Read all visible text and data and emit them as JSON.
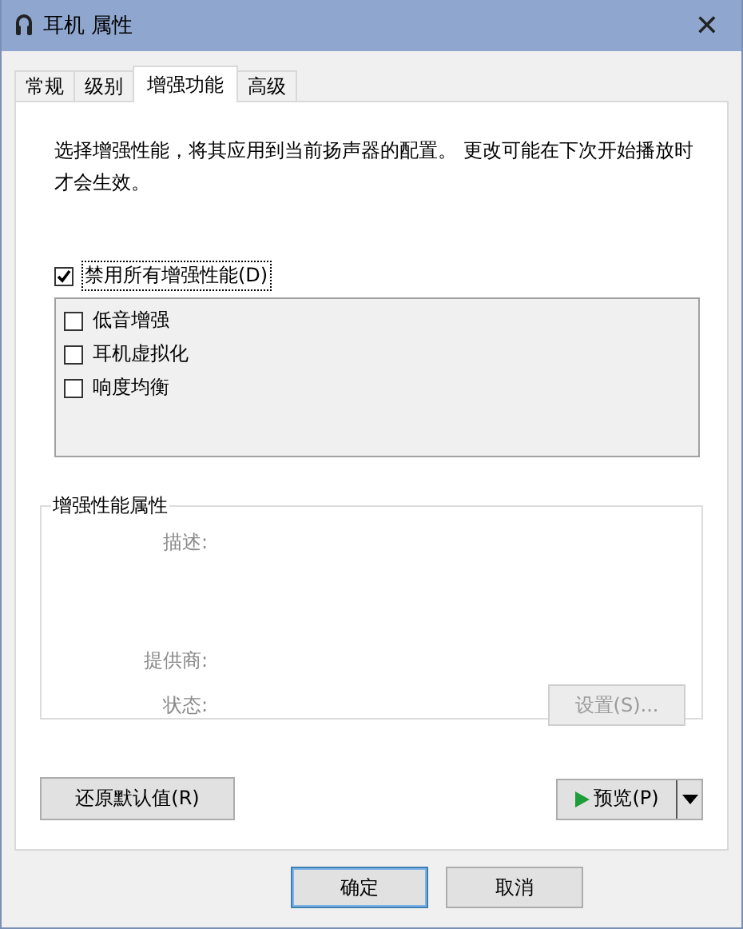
{
  "window": {
    "title": "耳机 属性",
    "close": "✕"
  },
  "tabs": [
    {
      "label": "常规",
      "selected": false
    },
    {
      "label": "级别",
      "selected": false
    },
    {
      "label": "增强功能",
      "selected": true
    },
    {
      "label": "高级",
      "selected": false
    }
  ],
  "description": "选择增强性能，将其应用到当前扬声器的配置。 更改可能在下次开始播放时才会生效。",
  "disable_all": {
    "label": "禁用所有增强性能(D)",
    "checked": true
  },
  "enhancements": [
    {
      "label": "低音增强",
      "checked": false
    },
    {
      "label": "耳机虚拟化",
      "checked": false
    },
    {
      "label": "响度均衡",
      "checked": false
    }
  ],
  "properties": {
    "title": "增强性能属性",
    "fields": [
      {
        "label": "描述:"
      },
      {
        "label": "提供商:"
      },
      {
        "label": "状态:"
      }
    ],
    "settings_button": {
      "label": "设置(S)...",
      "disabled": true
    }
  },
  "restore_button": "还原默认值(R)",
  "preview_button": "预览(P)",
  "buttons": [
    {
      "label": "确定",
      "default": true
    },
    {
      "label": "取消",
      "default": false
    }
  ]
}
